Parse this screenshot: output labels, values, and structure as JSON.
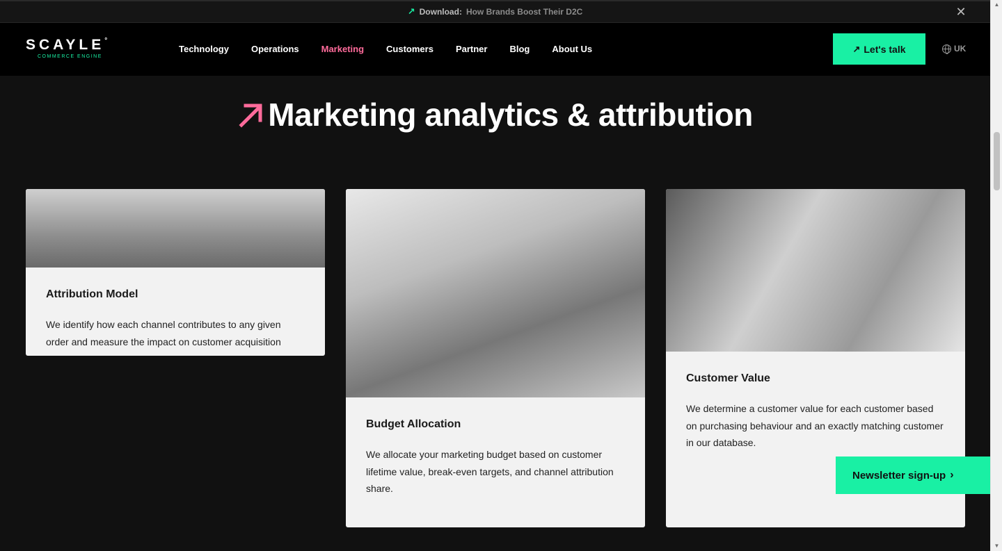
{
  "topbar": {
    "download_label": "Download:",
    "link_text": "How Brands Boost Their D2C"
  },
  "header": {
    "logo_text": "SCAYLE",
    "logo_sub": "COMMERCE ENGINE",
    "nav": [
      {
        "label": "Technology"
      },
      {
        "label": "Operations"
      },
      {
        "label": "Marketing",
        "active": true
      },
      {
        "label": "Customers"
      },
      {
        "label": "Partner"
      },
      {
        "label": "Blog"
      },
      {
        "label": "About Us"
      }
    ],
    "cta_label": "Let's talk",
    "lang": "UK"
  },
  "page": {
    "title": "Marketing analytics & attribution"
  },
  "cards": [
    {
      "title": "Attribution Model",
      "text": "We identify how each channel contributes to any given order and measure the impact on customer acquisition"
    },
    {
      "title": "Budget Allocation",
      "text": "We allocate your marketing budget based on customer lifetime value, break-even targets, and channel attribution share."
    },
    {
      "title": "Customer Value",
      "text": "We determine a customer value for each customer based on purchasing behaviour and an exactly matching customer in our database."
    }
  ],
  "newsletter": {
    "label": "Newsletter sign-up"
  },
  "colors": {
    "accent_green": "#19f0a4",
    "accent_pink": "#ff6b9b",
    "background": "#111111"
  }
}
